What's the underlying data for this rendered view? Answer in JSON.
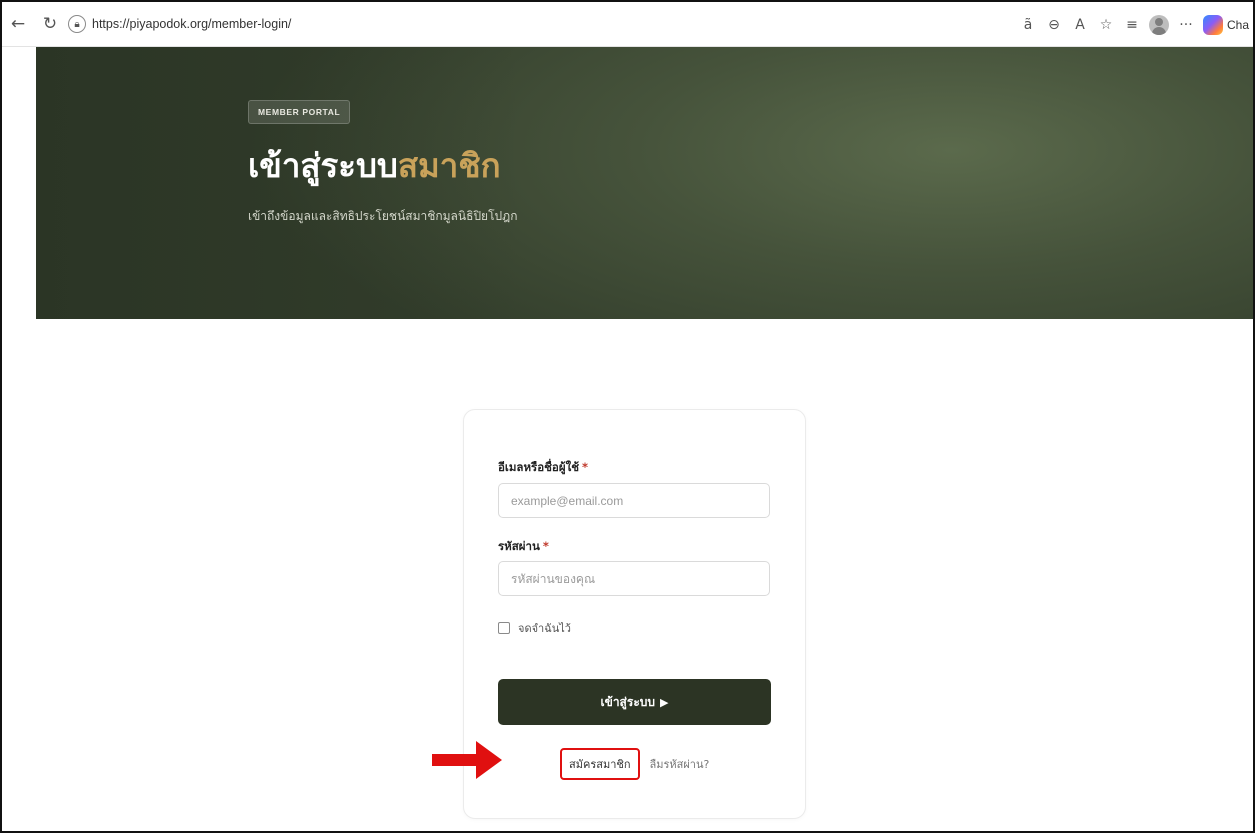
{
  "browser": {
    "url": "https://piyapodok.org/member-login/",
    "right_icons": [
      "read-aloud-icon",
      "zoom-out-icon",
      "read-aloud-a-icon",
      "favorite-star-icon",
      "favorites-list-icon",
      "profile-icon",
      "more-icon",
      "copilot-icon"
    ],
    "copilot_label": "Cha"
  },
  "hero": {
    "badge": "MEMBER PORTAL",
    "title_main": "เข้าสู่ระบบ",
    "title_accent": "สมาชิก",
    "subtitle": "เข้าถึงข้อมูลและสิทธิประโยชน์สมาชิกมูลนิธิปิยโปฎก",
    "accent_color": "#c9a25a",
    "bg_color": "#3e4a33"
  },
  "login_form": {
    "email_label": "อีเมลหรือชื่อผู้ใช้",
    "email_placeholder": "example@email.com",
    "password_label": "รหัสผ่าน",
    "password_placeholder": "รหัสผ่านของคุณ",
    "required_mark": "*",
    "remember_label": "จดจำฉันไว้",
    "remember_checked": false,
    "submit_label": "เข้าสู่ระบบ",
    "submit_arrow": "▶",
    "register_link": "สมัครสมาชิก",
    "forgot_link": "ลืมรหัสผ่าน?",
    "button_color": "#2c3424"
  },
  "annotation": {
    "highlight_color": "#e01010"
  }
}
